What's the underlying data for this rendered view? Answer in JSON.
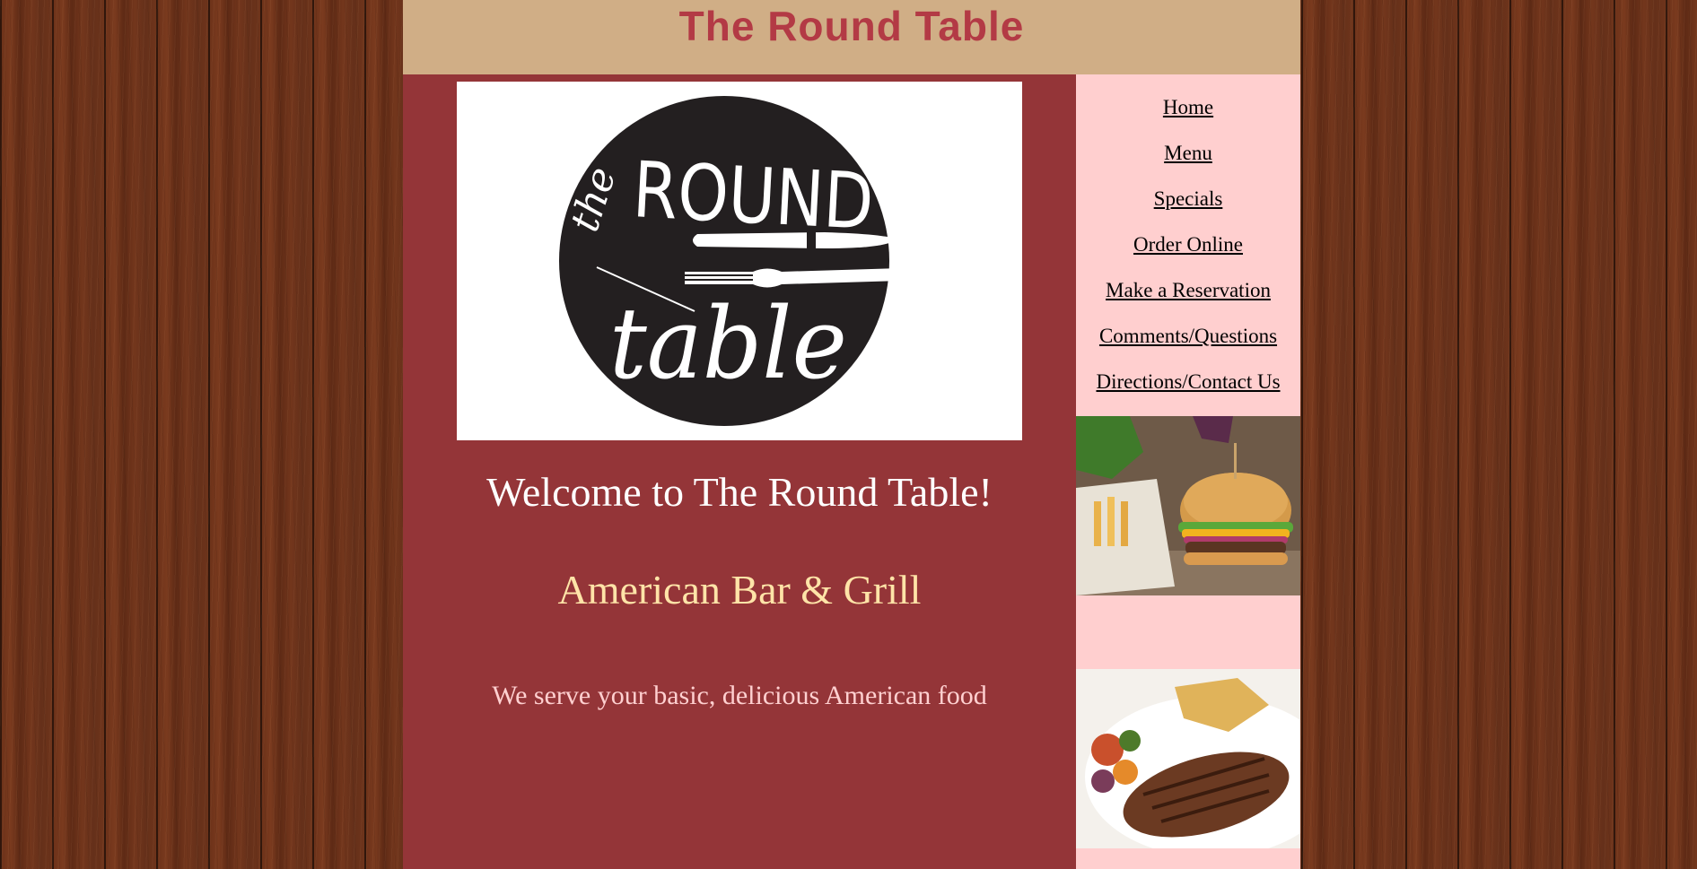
{
  "site": {
    "banner_title": "The Round Table"
  },
  "logo": {
    "word_the": "the",
    "word_round": "ROUND",
    "word_table": "table"
  },
  "main": {
    "welcome": "Welcome to The Round Table!",
    "subtitle": "American Bar & Grill",
    "tagline": "We serve your basic, delicious American food"
  },
  "nav": {
    "items": [
      {
        "label": "Home"
      },
      {
        "label": "Menu"
      },
      {
        "label": "Specials"
      },
      {
        "label": "Order Online"
      },
      {
        "label": "Make a Reservation"
      },
      {
        "label": "Comments/Questions"
      },
      {
        "label": "Directions/Contact Us"
      }
    ]
  },
  "colors": {
    "banner_bg": "#d0ae86",
    "banner_text": "#b33a45",
    "main_bg": "#943538",
    "sidebar_bg": "#ffcfcf",
    "subtitle_text": "#ffe4a8",
    "tagline_text": "#ffd0d0"
  },
  "images": {
    "burger": "burger-and-fries-photo",
    "steak": "grilled-steak-with-vegetables-photo"
  }
}
